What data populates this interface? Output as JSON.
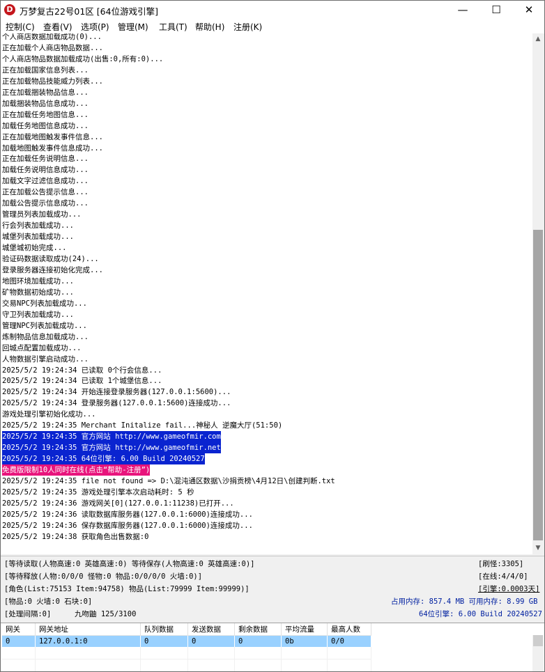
{
  "window": {
    "title": "万梦复古22号01区 [64位游戏引擎]",
    "minimize": "—",
    "maximize": "☐",
    "close": "✕",
    "icon_letter": "D"
  },
  "menu": [
    "控制(C)",
    "查看(V)",
    "选项(P)",
    "管理(M)",
    "工具(T)",
    "帮助(H)",
    "注册(K)"
  ],
  "log": [
    {
      "text": "个人商店数据加载成功(0)...",
      "style": "normal"
    },
    {
      "text": "正在加载个人商店物品数据...",
      "style": "normal"
    },
    {
      "text": "个人商店物品数据加载成功(出售:0,所有:0)...",
      "style": "normal"
    },
    {
      "text": "正在加载国家信息列表...",
      "style": "normal"
    },
    {
      "text": "正在加载物品技能威力列表...",
      "style": "normal"
    },
    {
      "text": "正在加载捆装物品信息...",
      "style": "normal"
    },
    {
      "text": "加载捆装物品信息成功...",
      "style": "normal"
    },
    {
      "text": "正在加载任务地图信息...",
      "style": "normal"
    },
    {
      "text": "加载任务地图信息成功...",
      "style": "normal"
    },
    {
      "text": "正在加载地图触发事件信息...",
      "style": "normal"
    },
    {
      "text": "加载地图触发事件信息成功...",
      "style": "normal"
    },
    {
      "text": "正在加载任务说明信息...",
      "style": "normal"
    },
    {
      "text": "加载任务说明信息成功...",
      "style": "normal"
    },
    {
      "text": "加载文字过滤信息成功...",
      "style": "normal"
    },
    {
      "text": "正在加载公告提示信息...",
      "style": "normal"
    },
    {
      "text": "加载公告提示信息成功...",
      "style": "normal"
    },
    {
      "text": "管理员列表加载成功...",
      "style": "normal"
    },
    {
      "text": "行会列表加载成功...",
      "style": "normal"
    },
    {
      "text": "城堡列表加载成功...",
      "style": "normal"
    },
    {
      "text": "城堡城初始完成...",
      "style": "normal"
    },
    {
      "text": "验证码数据读取成功(24)...",
      "style": "normal"
    },
    {
      "text": "登录服务器连接初始化完成...",
      "style": "normal"
    },
    {
      "text": "地图环境加载成功...",
      "style": "normal"
    },
    {
      "text": "矿物数据初始成功...",
      "style": "normal"
    },
    {
      "text": "交易NPC列表加载成功...",
      "style": "normal"
    },
    {
      "text": "守卫列表加载成功...",
      "style": "normal"
    },
    {
      "text": "管理NPC列表加载成功...",
      "style": "normal"
    },
    {
      "text": "炼制物品信息加载成功...",
      "style": "normal"
    },
    {
      "text": "回城点配置加载成功...",
      "style": "normal"
    },
    {
      "text": "人物数据引擎启动成功...",
      "style": "normal"
    },
    {
      "text": "2025/5/2 19:24:34 已读取 0个行会信息...",
      "style": "normal"
    },
    {
      "text": "2025/5/2 19:24:34 已读取 1个城堡信息...",
      "style": "normal"
    },
    {
      "text": "2025/5/2 19:24:34 开始连接登录服务器(127.0.0.1:5600)...",
      "style": "normal"
    },
    {
      "text": "2025/5/2 19:24:34 登录服务器(127.0.0.1:5600)连接成功...",
      "style": "normal"
    },
    {
      "text": "游戏处理引擎初始化成功...",
      "style": "normal"
    },
    {
      "text": "2025/5/2 19:24:35 Merchant Initalize fail...神秘人 逆魔大厅(51:50)",
      "style": "normal"
    },
    {
      "text": "2025/5/2 19:24:35 官方网站 http://www.gameofmir.com",
      "style": "selected"
    },
    {
      "text": "2025/5/2 19:24:35 官方网站 http://www.gameofmir.net",
      "style": "selected"
    },
    {
      "text": "2025/5/2 19:24:35 64位引擎: 6.00 Build 20240527",
      "style": "selected"
    },
    {
      "text": "免费版限制10人同时在线(点击“帮助-注册”)",
      "style": "pink"
    },
    {
      "text": "2025/5/2 19:24:35 file not found => D:\\混沌通区数据\\沙捐贡榜\\4月12日\\创建判断.txt",
      "style": "normal"
    },
    {
      "text": "2025/5/2 19:24:35 游戏处理引擎本次启动耗时: 5 秒",
      "style": "normal"
    },
    {
      "text": "2025/5/2 19:24:36 游戏网关[0](127.0.0.1:11238)已打开...",
      "style": "normal"
    },
    {
      "text": "2025/5/2 19:24:36 读取数据库服务器(127.0.0.1:6000)连接成功...",
      "style": "normal"
    },
    {
      "text": "2025/5/2 19:24:36 保存数据库服务器(127.0.0.1:6000)连接成功...",
      "style": "normal"
    },
    {
      "text": "2025/5/2 19:24:38 获取角色出售数据:0",
      "style": "normal"
    }
  ],
  "status": {
    "row1_left": "[等待读取(人物高速:0 英雄高速:0) 等待保存(人物高速:0 英雄高速:0)]",
    "row1_right": "[刷怪:3305]",
    "row2_left": "[等待释放(人物:0/0/0 怪物:0 物品:0/0/0/0 火墙:0)]",
    "row2_right": "[在线:4/4/0]",
    "row3_left": "[角色(List:75153 Item:94758) 物品(List:79999 Item:99999)]",
    "row3_right": "[引擎:0.0003天]",
    "row4_left": "[物品:0 火墙:0 石块:0]",
    "row4_right": "占用内存: 857.4 MB 可用内存: 8.99 GB",
    "row5_left": "[处理间隔:0]",
    "row5_mid": "九吻鼬 125/3100",
    "row5_right": "64位引擎: 6.00 Build 20240527"
  },
  "gateway_table": {
    "headers": [
      "网关",
      "网关地址",
      "队列数据",
      "发送数据",
      "剩余数据",
      "平均流量",
      "最高人数"
    ],
    "rows": [
      [
        "0",
        "127.0.0.1:0",
        "0",
        "0",
        "0",
        "0b",
        "0/0"
      ]
    ]
  }
}
